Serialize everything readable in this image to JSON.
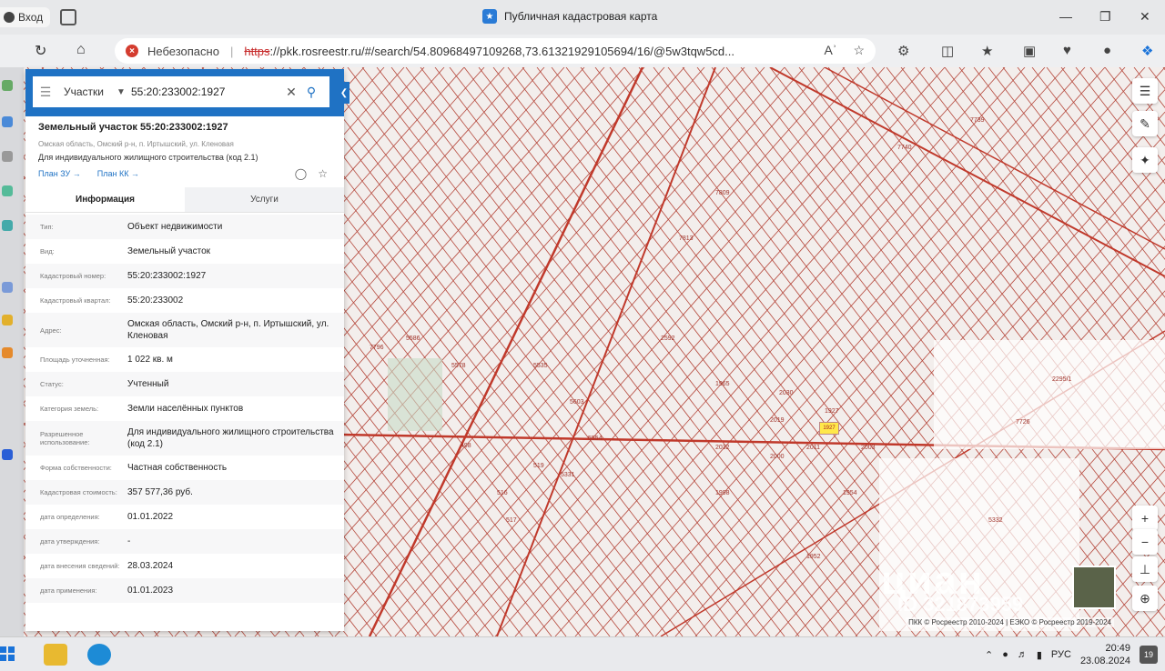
{
  "browser": {
    "login_tab": "Вход",
    "window_title": "Публичная кадастровая карта",
    "security_label": "Небезопасно",
    "url_scheme": "https",
    "url_rest": "://pkk.rosreestr.ru/#/search/54.80968497109268,73.61321929105694/16/@5w3tqw5cd...",
    "read_aloud_icon": "Aʾ"
  },
  "search": {
    "type_label": "Участки",
    "query": "55:20:233002:1927"
  },
  "object": {
    "title": "Земельный участок 55:20:233002:1927",
    "address_short": "Омская область, Омский р-н, п. Иртышский, ул. Кленовая",
    "use_short": "Для индивидуального жилищного строительства (код 2.1)",
    "link_plan_zu": "План ЗУ →",
    "link_plan_kk": "План КК →"
  },
  "tabs": {
    "info": "Информация",
    "services": "Услуги"
  },
  "attributes": [
    {
      "label": "Тип:",
      "value": "Объект недвижимости"
    },
    {
      "label": "Вид:",
      "value": "Земельный участок"
    },
    {
      "label": "Кадастровый номер:",
      "value": "55:20:233002:1927"
    },
    {
      "label": "Кадастровый квартал:",
      "value": "55:20:233002"
    },
    {
      "label": "Адрес:",
      "value": "Омская область, Омский р-н, п. Иртышский, ул. Кленовая"
    },
    {
      "label": "Площадь уточненная:",
      "value": "1 022 кв. м"
    },
    {
      "label": "Статус:",
      "value": "Учтенный"
    },
    {
      "label": "Категория земель:",
      "value": "Земли населённых пунктов"
    },
    {
      "label": "Разрешенное использование:",
      "value": "Для индивидуального жилищного строительства (код 2.1)"
    },
    {
      "label": "Форма собственности:",
      "value": "Частная собственность"
    },
    {
      "label": "Кадастровая стоимость:",
      "value": "357 577,36 руб."
    },
    {
      "label": "дата определения:",
      "value": "01.01.2022"
    },
    {
      "label": "дата утверждения:",
      "value": "-"
    },
    {
      "label": "дата внесения сведений:",
      "value": "28.03.2024"
    },
    {
      "label": "дата применения:",
      "value": "01.01.2023"
    }
  ],
  "map": {
    "selected_parcel_label": "1927",
    "attribution": "ПКК © Росреестр 2010-2024 | ЕЭКО © Росреестр 2019-2024",
    "watermark": "циан",
    "watermark_id": "ID 321873959",
    "parcel_labels": [
      "7796",
      "5586",
      "5578",
      "5535",
      "5603",
      "5554",
      "2592",
      "1965",
      "2295/1",
      "7726",
      "5332",
      "2019",
      "2011",
      "1998",
      "1952",
      "7740",
      "7739",
      "2000",
      "1954",
      "2032",
      "498",
      "516",
      "517",
      "519",
      "5331",
      "7813",
      "7809",
      "2030",
      "1927",
      "2003"
    ],
    "colors": {
      "parcel_line": "#b5473b",
      "road_line": "#c0392b",
      "background": "#f3eeec"
    }
  },
  "taskbar": {
    "language": "РУС",
    "time": "20:49",
    "date": "23.08.2024",
    "notifications": "19"
  }
}
